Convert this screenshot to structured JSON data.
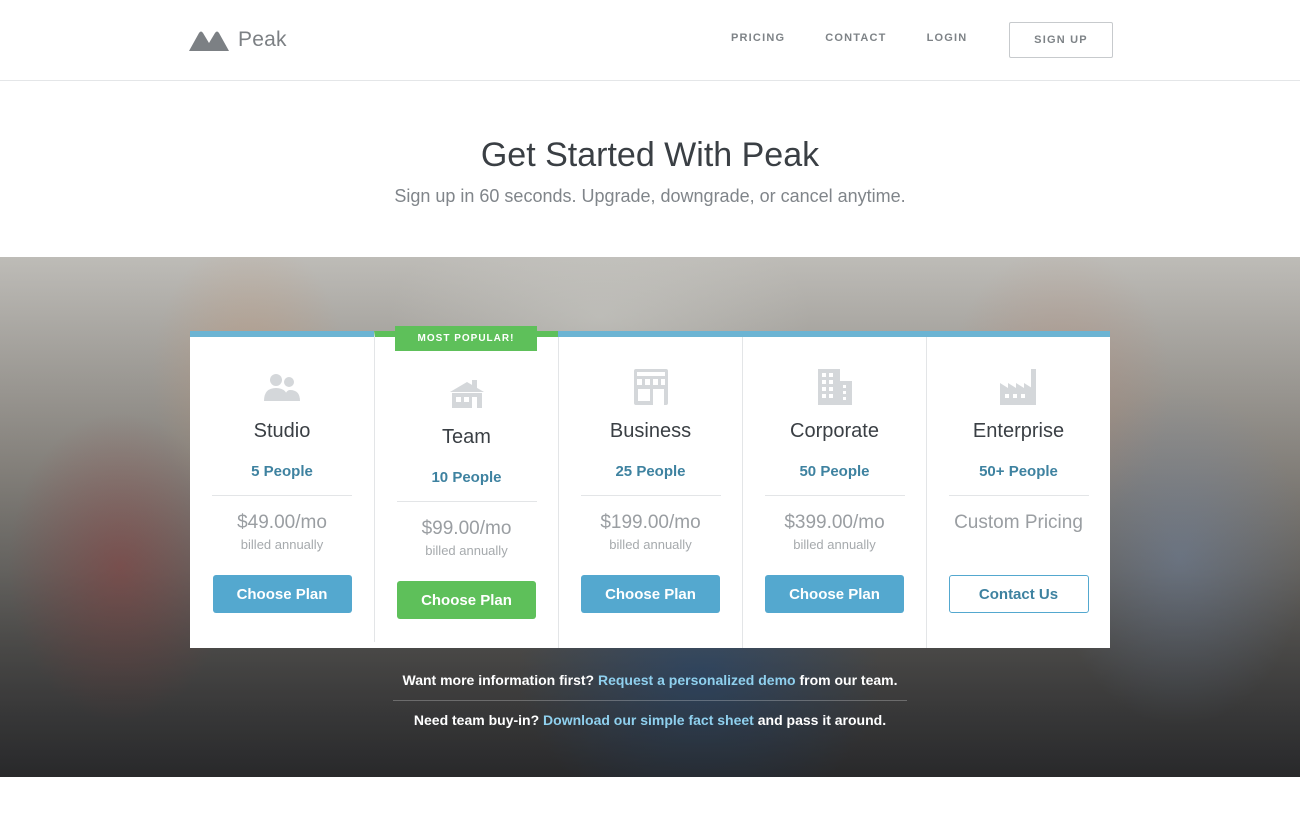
{
  "brand": {
    "name": "Peak",
    "logo_color": "#7c8084"
  },
  "nav": {
    "links": [
      "PRICING",
      "CONTACT",
      "LOGIN"
    ],
    "signup_label": "SIGN UP"
  },
  "hero": {
    "title": "Get Started With Peak",
    "subtitle": "Sign up in 60 seconds. Upgrade, downgrade, or cancel anytime."
  },
  "plans": [
    {
      "icon": "people-icon",
      "name": "Studio",
      "people": "5 People",
      "price": "$49.00/mo",
      "billing": "billed annually",
      "button": "Choose Plan"
    },
    {
      "icon": "house-icon",
      "name": "Team",
      "people": "10 People",
      "price": "$99.00/mo",
      "billing": "billed annually",
      "button": "Choose Plan",
      "badge": "MOST POPULAR!"
    },
    {
      "icon": "storefront-icon",
      "name": "Business",
      "people": "25 People",
      "price": "$199.00/mo",
      "billing": "billed annually",
      "button": "Choose Plan"
    },
    {
      "icon": "office-building-icon",
      "name": "Corporate",
      "people": "50 People",
      "price": "$399.00/mo",
      "billing": "billed annually",
      "button": "Choose Plan"
    },
    {
      "icon": "factory-icon",
      "name": "Enterprise",
      "people": "50+ People",
      "price": "Custom Pricing",
      "billing": "",
      "button": "Contact Us"
    }
  ],
  "info": {
    "line1_prefix": "Want more information first?",
    "line1_link": "Request a personalized demo",
    "line1_suffix": "from our team.",
    "line2_prefix": "Need team buy-in?",
    "line2_link": "Download our simple fact sheet",
    "line2_suffix": "and pass it around."
  },
  "colors": {
    "accent_blue": "#54a8cf",
    "accent_green": "#5ec05a",
    "people_text": "#3e82a0",
    "top_border": "#6cb4d3"
  }
}
